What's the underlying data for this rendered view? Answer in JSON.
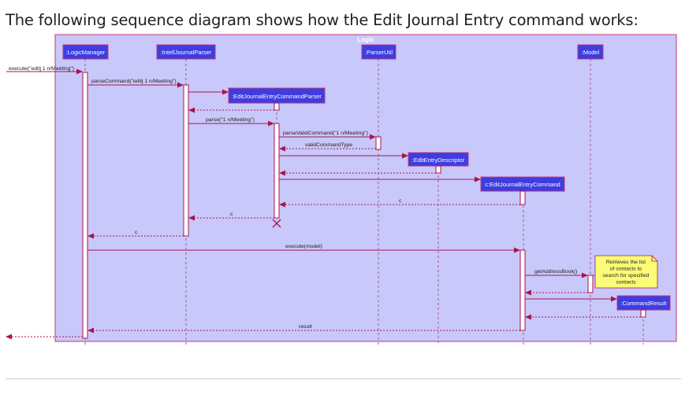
{
  "page": {
    "heading": "The following sequence diagram shows how the Edit Journal Entry command works:"
  },
  "diagram": {
    "frame_label": "Logic",
    "participants": {
      "logic_manager": ":LogicManager",
      "intell_journal_parser": ":IntellJournalParser",
      "parser_util": ":ParserUtil",
      "model": ":Model",
      "edit_journal_entry_command_parser": ":EditJournalEntryCommandParser",
      "edit_entry_descriptor": ":EditEntryDescriptor",
      "edit_journal_entry_command": "c:EditJournalEntryCommand",
      "command_result": ":CommandResult"
    },
    "messages": {
      "execute_input": "execute(\"editj 1 n/Meeting\")",
      "parse_command": "parseCommand(\"editj 1 n/Meeting\")",
      "parse": "parse(\"1 n/Meeting\")",
      "parse_valid_command": "parseValidCommand(\"1 n/Meeting\")",
      "valid_command_type": "validCommandType",
      "return_c_from_command": "c",
      "return_c_from_parser": "c",
      "return_c_to_manager": "c",
      "execute_model": "execute(model)",
      "get_address_book": "getAddressBook()",
      "result": "result"
    },
    "note": {
      "lines": [
        "Retrieves the list",
        "of contacts to",
        "search for specified",
        "contacts"
      ]
    },
    "colors": {
      "frame_fill": "#c8c8fa",
      "frame_border": "#c0367a",
      "participant_fill": "#3d3de0",
      "participant_text": "#ffffff",
      "activation_fill": "#ffffff",
      "arrow": "#a8164e",
      "lifeline": "#a05a8c",
      "note_fill": "#fbfb77",
      "destroy": "#a8164e"
    }
  }
}
